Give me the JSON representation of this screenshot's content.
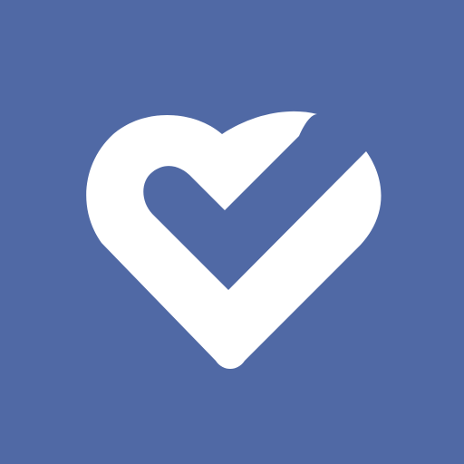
{
  "icon": {
    "name": "heart-check-icon",
    "background_color": "#5069A5",
    "foreground_color": "#FFFFFF"
  }
}
